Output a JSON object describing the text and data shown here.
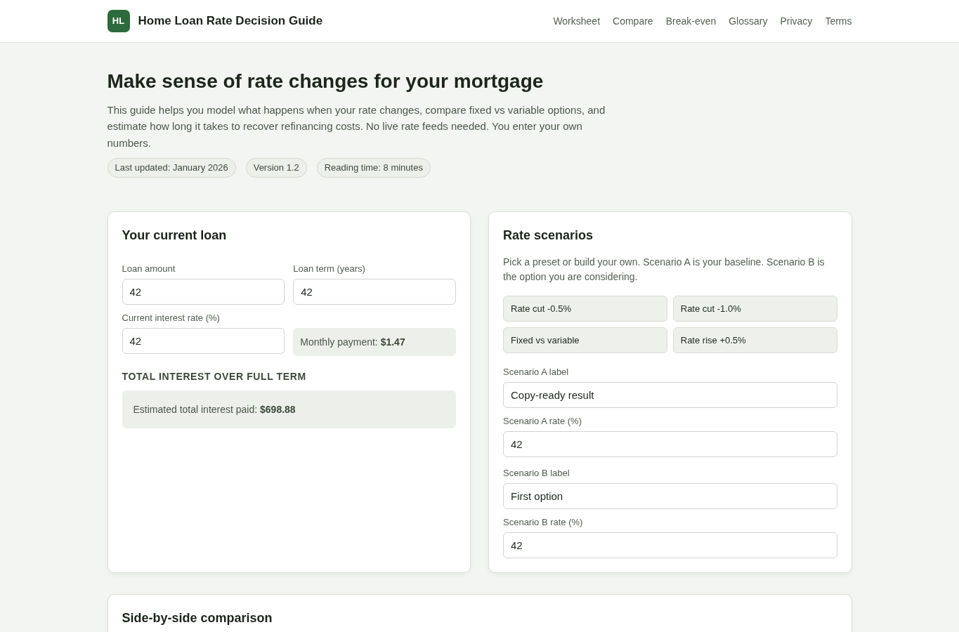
{
  "header": {
    "logo_text": "HL",
    "title": "Home Loan Rate Decision Guide",
    "nav": [
      {
        "label": "Worksheet"
      },
      {
        "label": "Compare"
      },
      {
        "label": "Break-even"
      },
      {
        "label": "Glossary"
      },
      {
        "label": "Privacy"
      },
      {
        "label": "Terms"
      }
    ]
  },
  "hero": {
    "title": "Make sense of rate changes for your mortgage",
    "description": "This guide helps you model what happens when your rate changes, compare fixed vs variable options, and estimate how long it takes to recover refinancing costs. No live rate feeds needed. You enter your own numbers.",
    "meta": [
      "Last updated: January 2026",
      "Version 1.2",
      "Reading time: 8 minutes"
    ]
  },
  "current_loan": {
    "title": "Your current loan",
    "fields": [
      {
        "label": "Loan amount",
        "value": "42"
      },
      {
        "label": "Loan term (years)",
        "value": "42"
      },
      {
        "label": "Current interest rate (%)",
        "value": "42"
      }
    ],
    "monthly_payment": "Monthly payment: **$1.47**",
    "section_heading": "TOTAL INTEREST OVER FULL TERM",
    "total_interest": "Estimated total interest paid: **$698.88**"
  },
  "rate_scenarios": {
    "title": "Rate scenarios",
    "description": "Pick a preset or build your own. Scenario A is your baseline. Scenario B is the option you are considering.",
    "presets": [
      "Rate cut -0.5%",
      "Rate cut -1.0%",
      "Fixed vs variable",
      "Rate rise +0.5%"
    ],
    "scenarios": [
      {
        "fields": [
          {
            "label": "Scenario A label",
            "value": "Copy-ready result"
          },
          {
            "label": "Scenario A rate (%)",
            "value": "42"
          }
        ]
      },
      {
        "fields": [
          {
            "label": "Scenario B label",
            "value": "First option"
          },
          {
            "label": "Scenario B rate (%)",
            "value": "42"
          }
        ]
      }
    ]
  },
  "comparison": {
    "title": "Side-by-side comparison"
  }
}
